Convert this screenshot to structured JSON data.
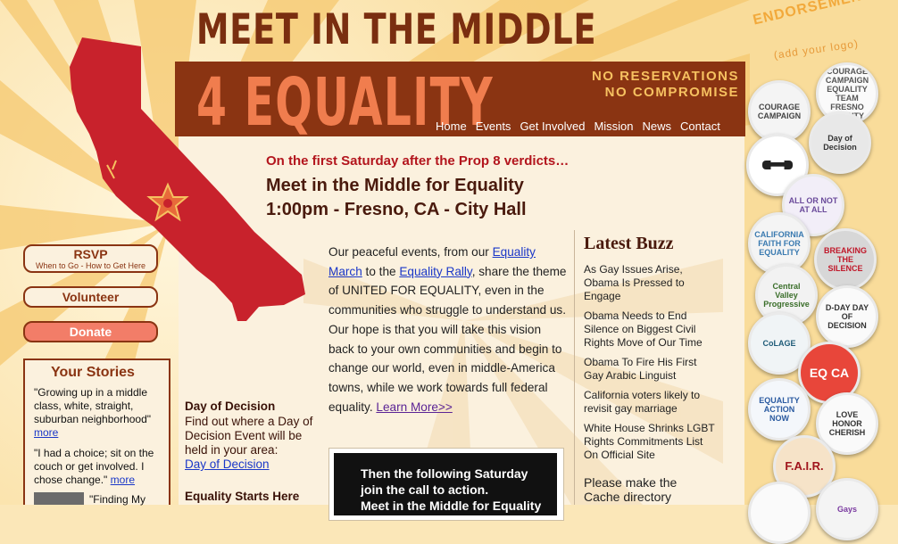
{
  "header": {
    "title_top": "MEET IN THE MIDDLE",
    "title_main": "4 EQUALITY",
    "slogan_line1": "NO RESERVATIONS",
    "slogan_line2": "NO COMPROMISE"
  },
  "nav": [
    "Home",
    "Events",
    "Get Involved",
    "Mission",
    "News",
    "Contact"
  ],
  "headline": {
    "kicker": "On the first Saturday after the Prop 8 verdicts…",
    "line1": "Meet in the Middle for Equality",
    "line2": "1:00pm - Fresno, CA - City Hall"
  },
  "body": {
    "p1": "Our peaceful events, from our ",
    "link1": "Equality March",
    "p2": " to the ",
    "link2": "Equality Rally",
    "p3": ", share the theme of UNITED FOR EQUALITY, even in the communities who struggle to understand us. Our hope is that you will take this vision back to your own communities and begin to change our world, even in middle-America towns, while we work towards full federal equality. ",
    "learn_more": "Learn More>>"
  },
  "video": {
    "line1": "Then the following Saturday",
    "line2": "join the call to action.",
    "line3": "Meet in the Middle for Equality"
  },
  "buzz": {
    "title": "Latest Buzz",
    "items": [
      "As Gay Issues Arise, Obama Is Pressed to Engage",
      "Obama Needs to End Silence on Biggest Civil Rights Move of Our Time",
      "Obama To Fire His First Gay Arabic Linguist",
      "California voters likely to revisit gay marriage",
      "White House Shrinks LGBT Rights Commitments List On Official Site",
      "Please make the Cache directory"
    ]
  },
  "left": {
    "rsvp_title": "RSVP",
    "rsvp_sub": "When to Go - How to Get Here",
    "volunteer": "Volunteer",
    "donate": "Donate",
    "stories_title": "Your Stories",
    "story1": "\"Growing up in a middle class, white, straight, suburban neighborhood\"",
    "story1_more": "more",
    "story2": "\"I had a choice; sit on the couch or get involved. I chose change.\"",
    "story2_more": "more",
    "story3": "\"Finding My"
  },
  "side": {
    "dod_head": "Day of Decision",
    "dod_text": "Find out where a Day of Decision Event will be held in your area:",
    "dod_link": "Day of Decision",
    "esh_head": "Equality Starts Here"
  },
  "endorse": {
    "title": "ENDORSEMENTS",
    "sub": "(add your logo)",
    "badges": [
      "COURAGE CAMPAIGN",
      "COURAGE CAMPAIGN EQUALITY TEAM FRESNO COUNTY",
      "=",
      "Day of Decision",
      "ALL OR NOT AT ALL",
      "CALIFORNIA FAITH FOR EQUALITY",
      "BREAKING THE SILENCE",
      "Central Valley Progressive",
      "D-DAY DAY OF DECISION",
      "CoLAGE",
      "EQ CA",
      "EQUALITY ACTION NOW",
      "LOVE HONOR CHERISH",
      "F.A.I.R.",
      "Gays"
    ]
  },
  "colors": {
    "brown": "#8a3412",
    "red": "#c8222c",
    "salmon": "#f27d68",
    "gold": "#f6c160"
  }
}
